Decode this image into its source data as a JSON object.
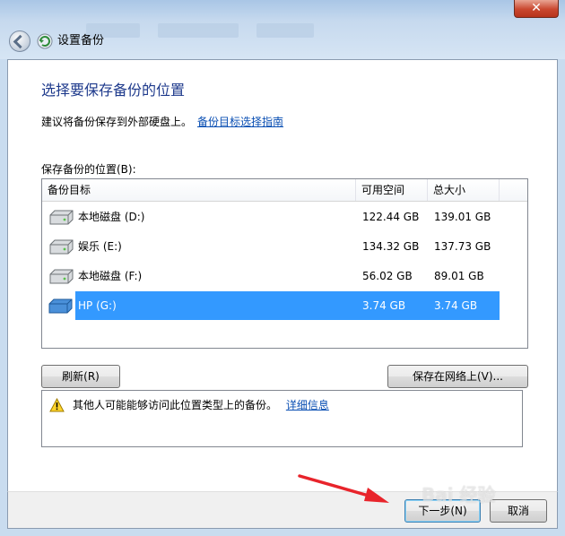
{
  "window": {
    "title": "设置备份",
    "close_glyph": "✕"
  },
  "page": {
    "heading": "选择要保存备份的位置",
    "description": "建议将备份保存到外部硬盘上。",
    "guide_link": "备份目标选择指南",
    "list_label": "保存备份的位置(B):"
  },
  "table": {
    "columns": [
      "备份目标",
      "可用空间",
      "总大小"
    ],
    "rows": [
      {
        "name": "本地磁盘 (D:)",
        "free": "122.44 GB",
        "total": "139.01 GB",
        "icon": "hard-drive-icon",
        "selected": false
      },
      {
        "name": "娱乐 (E:)",
        "free": "134.32 GB",
        "total": "137.73 GB",
        "icon": "hard-drive-icon",
        "selected": false
      },
      {
        "name": "本地磁盘 (F:)",
        "free": "56.02 GB",
        "total": "89.01 GB",
        "icon": "hard-drive-icon",
        "selected": false
      },
      {
        "name": "HP (G:)",
        "free": "3.74 GB",
        "total": "3.74 GB",
        "icon": "usb-drive-icon",
        "selected": true
      }
    ]
  },
  "buttons": {
    "refresh": "刷新(R)",
    "save_network": "保存在网络上(V)...",
    "next": "下一步(N)",
    "cancel": "取消"
  },
  "warning": {
    "text": "其他人可能能够访问此位置类型上的备份。",
    "link": "详细信息"
  },
  "watermark": "Bai 经验",
  "colors": {
    "heading": "#1e3a8c",
    "link": "#0a4fb3",
    "selection": "#3399ff",
    "arrow": "#e8242b"
  }
}
